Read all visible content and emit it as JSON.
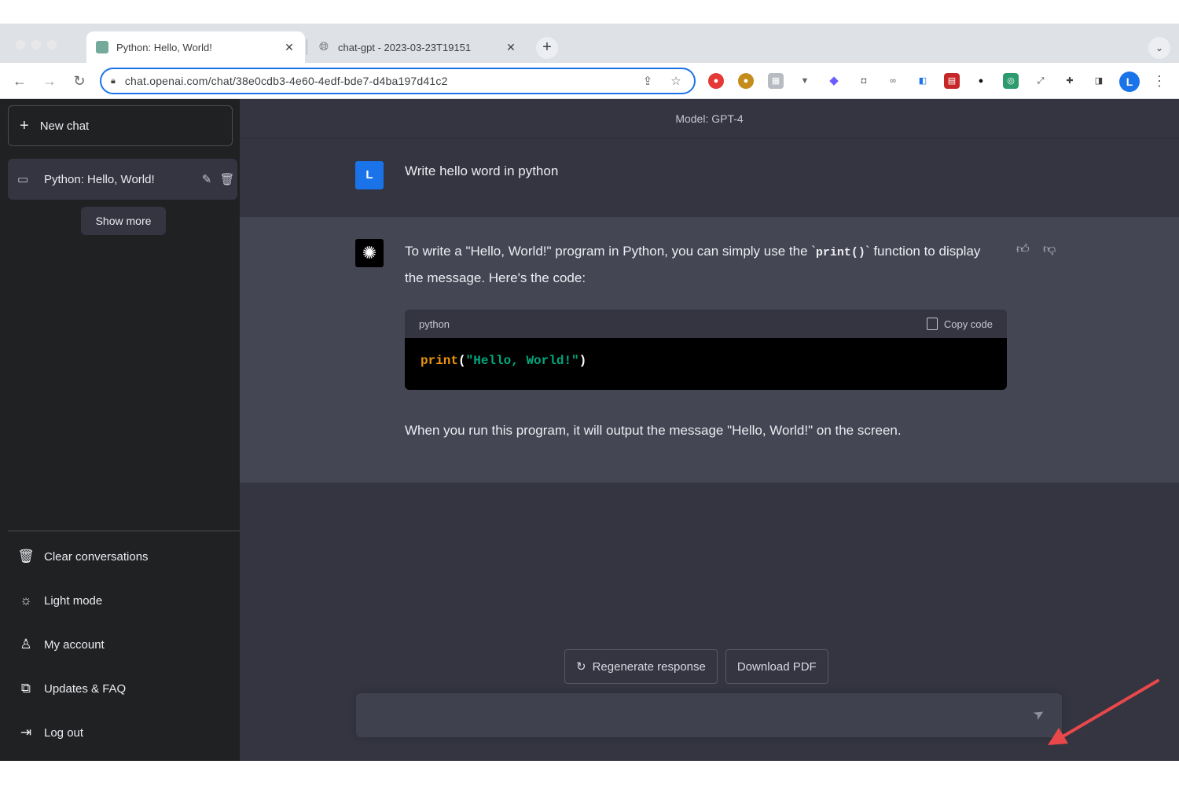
{
  "browser": {
    "tabs": [
      {
        "label": "Python: Hello, World!",
        "active": true
      },
      {
        "label": "chat-gpt - 2023-03-23T19151",
        "active": false
      }
    ],
    "new_tab": "+",
    "url": "chat.openai.com/chat/38e0cdb3-4e60-4edf-bde7-d4ba197d41c2",
    "profile_initial": "L"
  },
  "sidebar": {
    "new_chat_label": "New chat",
    "conversations": [
      {
        "label": "Python: Hello, World!"
      }
    ],
    "show_more_label": "Show more",
    "bottom_items": [
      {
        "label": "Clear conversations",
        "icon": "trash-icon"
      },
      {
        "label": "Light mode",
        "icon": "sun-icon"
      },
      {
        "label": "My account",
        "icon": "user-icon"
      },
      {
        "label": "Updates & FAQ",
        "icon": "external-link-icon"
      },
      {
        "label": "Log out",
        "icon": "logout-icon"
      }
    ]
  },
  "main": {
    "model_label": "Model: GPT-4",
    "user_message": {
      "avatar": "L",
      "text": "Write hello word in python"
    },
    "assistant_message": {
      "para1_before": "To write a \"Hello, World!\" program in Python, you can simply use the `",
      "para1_code": "print()",
      "para1_after": "` function to display the message. Here's the code:",
      "code_language": "python",
      "copy_label": "Copy code",
      "code_fn": "print",
      "code_open": "(",
      "code_string": "\"Hello, World!\"",
      "code_close": ")",
      "para2": "When you run this program, it will output the message \"Hello, World!\" on the screen."
    },
    "regenerate_label": "Regenerate response",
    "download_pdf_label": "Download PDF",
    "composer_placeholder": ""
  },
  "colors": {
    "sidebar_bg": "#202123",
    "main_bg": "#343541",
    "assistant_bg": "#444654",
    "accent": "#1a73e8",
    "annotation_arrow": "#e8484a"
  }
}
